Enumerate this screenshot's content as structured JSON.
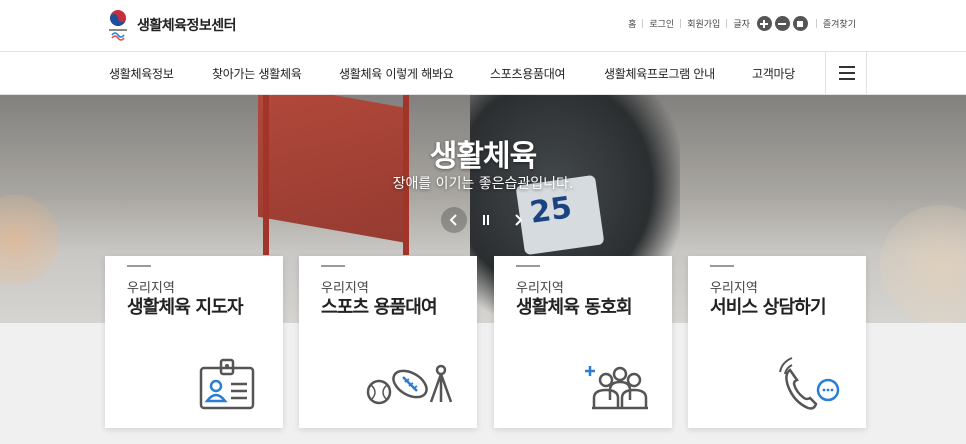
{
  "header": {
    "logo_text": "생활체육정보센터",
    "util_links": [
      "홈",
      "로그인",
      "회원가입"
    ],
    "font_size_label": "글자",
    "favorites_label": "즐겨찾기"
  },
  "nav": {
    "items": [
      "생활체육정보",
      "찾아가는 생활체육",
      "생활체육 이렇게 해봐요",
      "스포츠용품대여",
      "생활체육프로그램 안내",
      "고객마당"
    ]
  },
  "hero": {
    "title": "생활체육",
    "subtitle": "장애를 이기는 좋은습관입니다.",
    "bib_number": "25"
  },
  "cards": [
    {
      "region": "우리지역",
      "title": "생활체육 지도자",
      "icon": "id-card-icon"
    },
    {
      "region": "우리지역",
      "title": "스포츠 용품대여",
      "icon": "sports-equipment-icon"
    },
    {
      "region": "우리지역",
      "title": "생활체육 동호회",
      "icon": "group-people-icon"
    },
    {
      "region": "우리지역",
      "title": "서비스 상담하기",
      "icon": "phone-chat-icon"
    }
  ],
  "colors": {
    "accent_blue": "#2a7fd4",
    "icon_dark": "#555555",
    "flag_red": "#c94a3a"
  }
}
